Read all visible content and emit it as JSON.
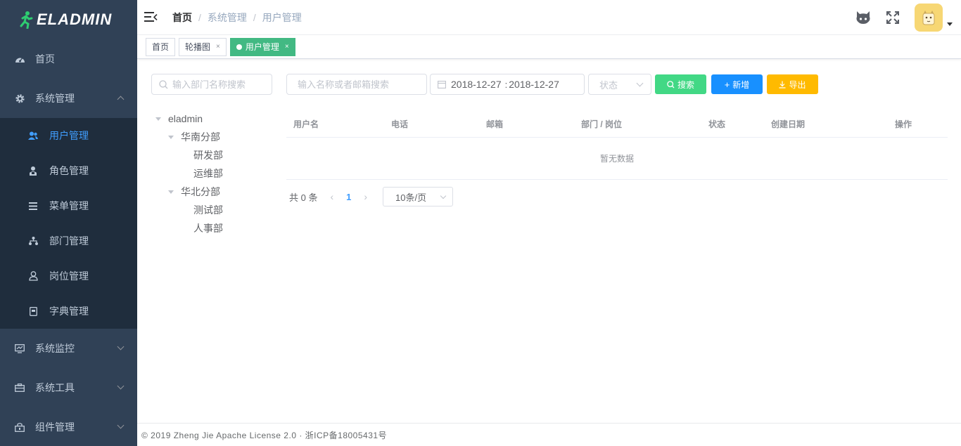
{
  "app": {
    "logo_text": "ELADMIN",
    "accent": "#409eff",
    "sidebar_bg": "#304156"
  },
  "sidebar": {
    "home": {
      "label": "首页",
      "icon": "dashboard-icon"
    },
    "system": {
      "label": "系统管理",
      "icon": "gear-icon"
    },
    "sub_items": [
      {
        "label": "用户管理",
        "icon": "user-icon"
      },
      {
        "label": "角色管理",
        "icon": "role-icon"
      },
      {
        "label": "菜单管理",
        "icon": "menu-list-icon"
      },
      {
        "label": "部门管理",
        "icon": "dept-tree-icon"
      },
      {
        "label": "岗位管理",
        "icon": "job-icon"
      },
      {
        "label": "字典管理",
        "icon": "dictionary-icon"
      }
    ],
    "monitor": {
      "label": "系统监控",
      "icon": "monitor-icon"
    },
    "tools": {
      "label": "系统工具",
      "icon": "toolbox-icon"
    },
    "components": {
      "label": "组件管理",
      "icon": "component-icon"
    }
  },
  "breadcrumb": {
    "home": "首页",
    "level1": "系统管理",
    "level2": "用户管理",
    "separator": "/"
  },
  "tags": {
    "home": "首页",
    "carousel": "轮播图",
    "user": "用户管理",
    "close": "×"
  },
  "dept_search": {
    "placeholder": "输入部门名称搜索"
  },
  "tree": {
    "root": "eladmin",
    "south": "华南分部",
    "south_children": [
      "研发部",
      "运维部"
    ],
    "north": "华北分部",
    "north_children": [
      "测试部",
      "人事部"
    ]
  },
  "toolbar": {
    "search_placeholder": "输入名称或者邮箱搜索",
    "date_start": "2018-12-27",
    "date_sep": ":",
    "date_end": "2018-12-27",
    "status_placeholder": "状态",
    "search_label": "搜索",
    "add_label": "新增",
    "export_label": "导出",
    "search_color": "#42d885",
    "add_color": "#1890ff",
    "export_color": "#ffba00"
  },
  "table": {
    "columns": [
      "用户名",
      "电话",
      "邮箱",
      "部门 / 岗位",
      "状态",
      "创建日期",
      "操作"
    ],
    "empty_text": "暂无数据"
  },
  "pagination": {
    "total_text": "共 0 条",
    "current_page": "1",
    "prev": "‹",
    "next": "›",
    "page_size": "10条/页"
  },
  "footer": {
    "text": "© 2019 Zheng Jie Apache License 2.0 · 浙ICP备18005431号"
  }
}
